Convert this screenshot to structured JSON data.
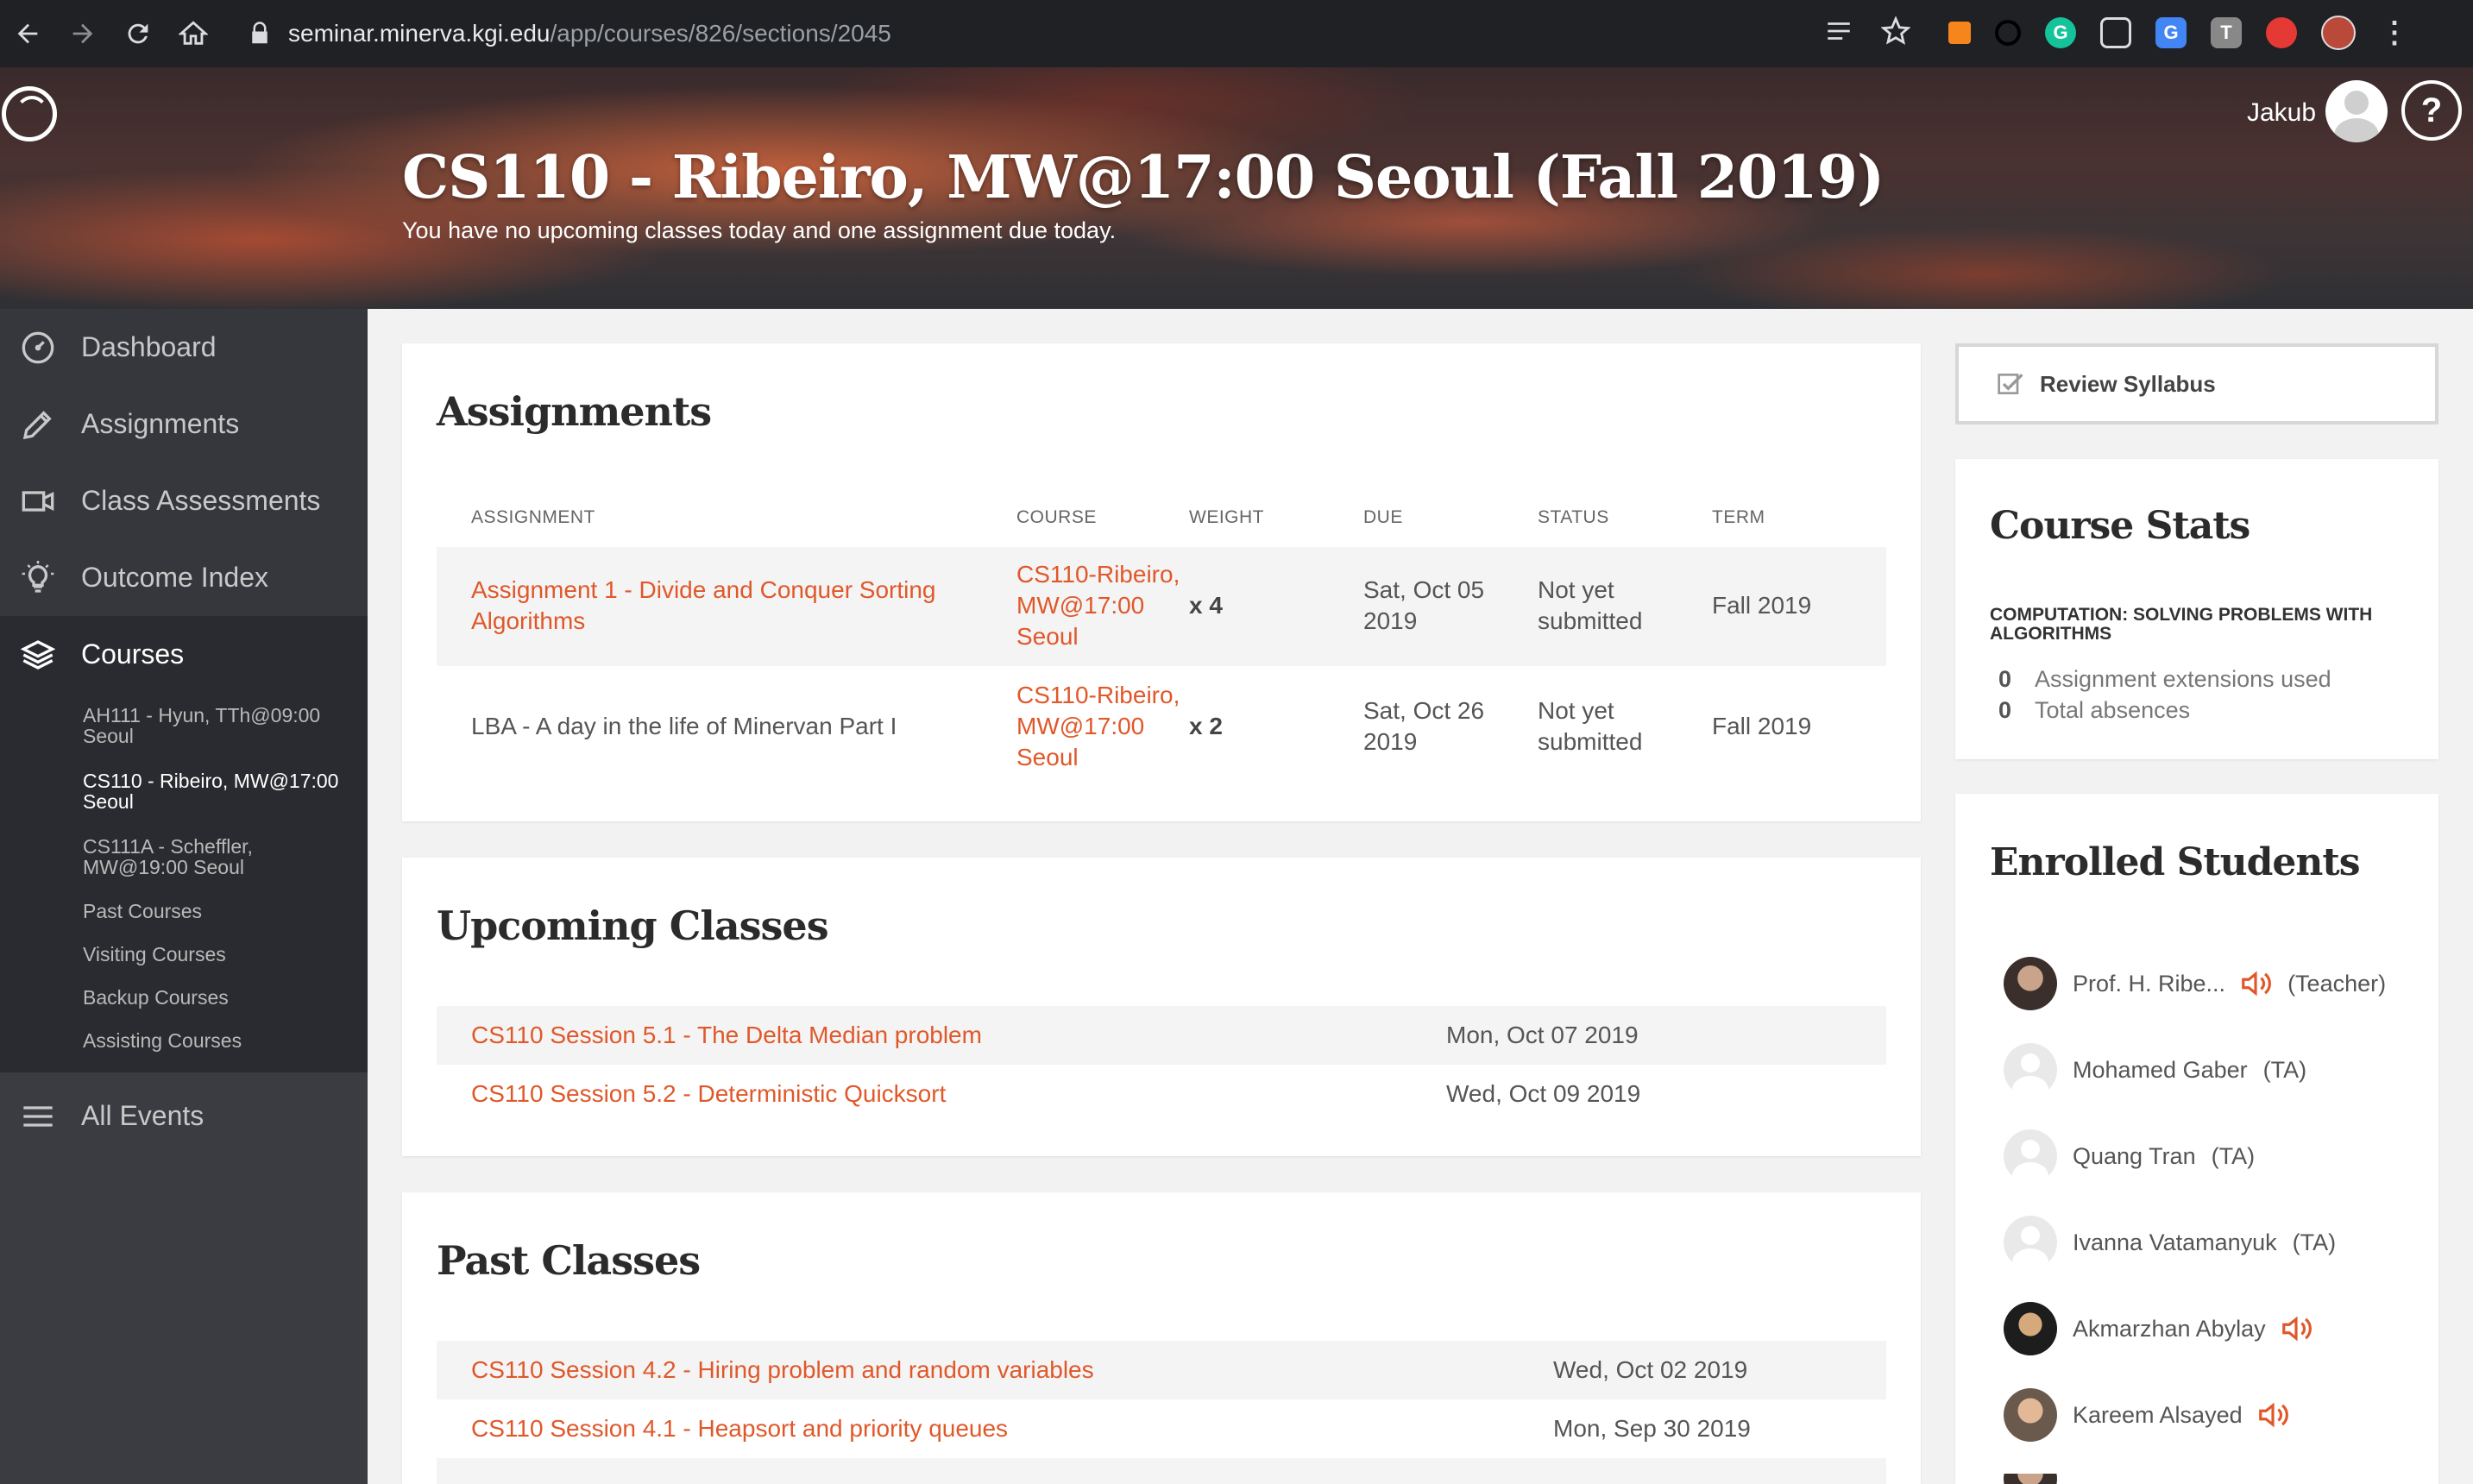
{
  "browser": {
    "url_host": "seminar.minerva.kgi.edu",
    "url_path": "/app/courses/826/sections/2045"
  },
  "header": {
    "title": "CS110 - Ribeiro, MW@17:00 Seoul (Fall 2019)",
    "subtitle": "You have no upcoming classes today and one assignment due today.",
    "user_name": "Jakub",
    "help_label": "?"
  },
  "sidebar": {
    "dashboard": "Dashboard",
    "assignments": "Assignments",
    "class_assessments": "Class Assessments",
    "outcome_index": "Outcome Index",
    "courses": "Courses",
    "course_list": [
      "AH111 - Hyun, TTh@09:00 Seoul",
      "CS110 - Ribeiro, MW@17:00 Seoul",
      "CS111A - Scheffler, MW@19:00 Seoul"
    ],
    "links": [
      "Past Courses",
      "Visiting Courses",
      "Backup Courses",
      "Assisting Courses"
    ],
    "all_events": "All Events"
  },
  "assignments": {
    "heading": "Assignments",
    "columns": [
      "ASSIGNMENT",
      "COURSE",
      "WEIGHT",
      "DUE",
      "STATUS",
      "TERM"
    ],
    "rows": [
      {
        "name_l1": "Assignment 1 - Divide and Conquer Sorting",
        "name_l2": "Algorithms",
        "course_l1": "CS110-Ribeiro,",
        "course_l2": "MW@17:00",
        "course_l3": "Seoul",
        "weight": "x 4",
        "due_l1": "Sat, Oct 05",
        "due_l2": "2019",
        "status_l1": "Not yet",
        "status_l2": "submitted",
        "term": "Fall 2019"
      },
      {
        "name_l1": "LBA - A day in the life of Minervan Part I",
        "name_l2": "",
        "course_l1": "CS110-Ribeiro,",
        "course_l2": "MW@17:00",
        "course_l3": "Seoul",
        "weight": "x 2",
        "due_l1": "Sat, Oct 26",
        "due_l2": "2019",
        "status_l1": "Not yet",
        "status_l2": "submitted",
        "term": "Fall 2019"
      }
    ]
  },
  "upcoming": {
    "heading": "Upcoming Classes",
    "rows": [
      {
        "title": "CS110 Session 5.1 - The Delta Median problem",
        "date": "Mon, Oct 07 2019"
      },
      {
        "title": "CS110 Session 5.2 - Deterministic Quicksort",
        "date": "Wed, Oct 09 2019"
      }
    ]
  },
  "past": {
    "heading": "Past Classes",
    "rows": [
      {
        "title": "CS110 Session 4.2 - Hiring problem and random variables",
        "date": "Wed, Oct 02 2019"
      },
      {
        "title": "CS110 Session 4.1 - Heapsort and priority queues",
        "date": "Mon, Sep 30 2019"
      }
    ]
  },
  "syllabus": {
    "label": "Review Syllabus"
  },
  "stats": {
    "heading": "Course Stats",
    "caption": "COMPUTATION: SOLVING PROBLEMS WITH ALGORITHMS",
    "items": [
      {
        "value": "0",
        "label": "Assignment extensions used"
      },
      {
        "value": "0",
        "label": "Total absences"
      }
    ]
  },
  "students": {
    "heading": "Enrolled Students",
    "list": [
      {
        "name": "Prof. H. Ribe...",
        "role": "(Teacher)"
      },
      {
        "name": "Mohamed Gaber",
        "role": "(TA)"
      },
      {
        "name": "Quang Tran",
        "role": "(TA)"
      },
      {
        "name": "Ivanna Vatamanyuk",
        "role": "(TA)"
      },
      {
        "name": "Akmarzhan Abylay",
        "role": ""
      },
      {
        "name": "Kareem Alsayed",
        "role": ""
      }
    ]
  },
  "colors": {
    "accent": "#e0582a",
    "sidebar": "#3a3c42",
    "sidebar_active": "#2a2b30"
  }
}
